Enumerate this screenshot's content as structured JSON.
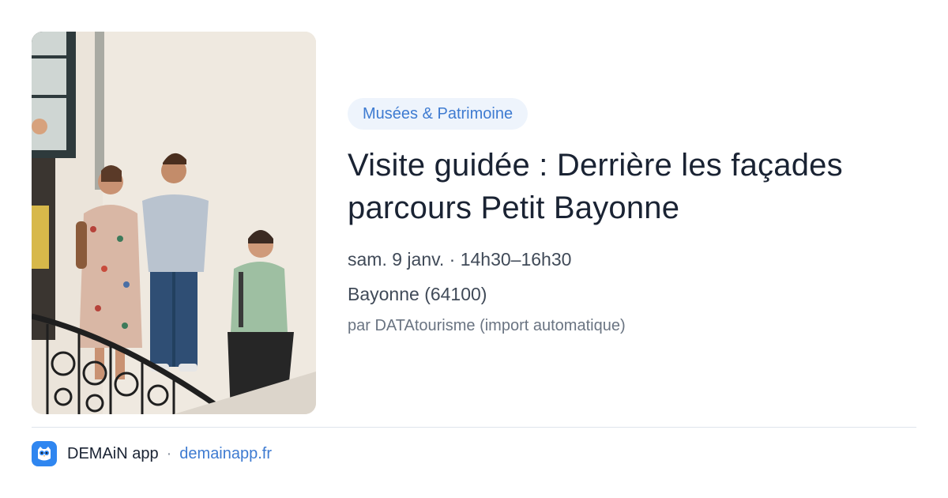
{
  "event": {
    "category": "Musées & Patrimoine",
    "title_line1": "Visite guidée : Derrière les façades",
    "title_line2": "parcours Petit Bayonne",
    "date": "sam. 9 janv. · 14h30–16h30",
    "location": "Bayonne (64100)",
    "source": "par DATAtourisme (import automatique)"
  },
  "footer": {
    "app_name": "DEMAiN app",
    "separator": "·",
    "domain": "demainapp.fr",
    "icon": "owl-icon"
  },
  "colors": {
    "accent": "#3e7bd1",
    "badge_bg": "#eef4fc",
    "title": "#1a2333",
    "app_icon_bg": "#2f86f0"
  }
}
